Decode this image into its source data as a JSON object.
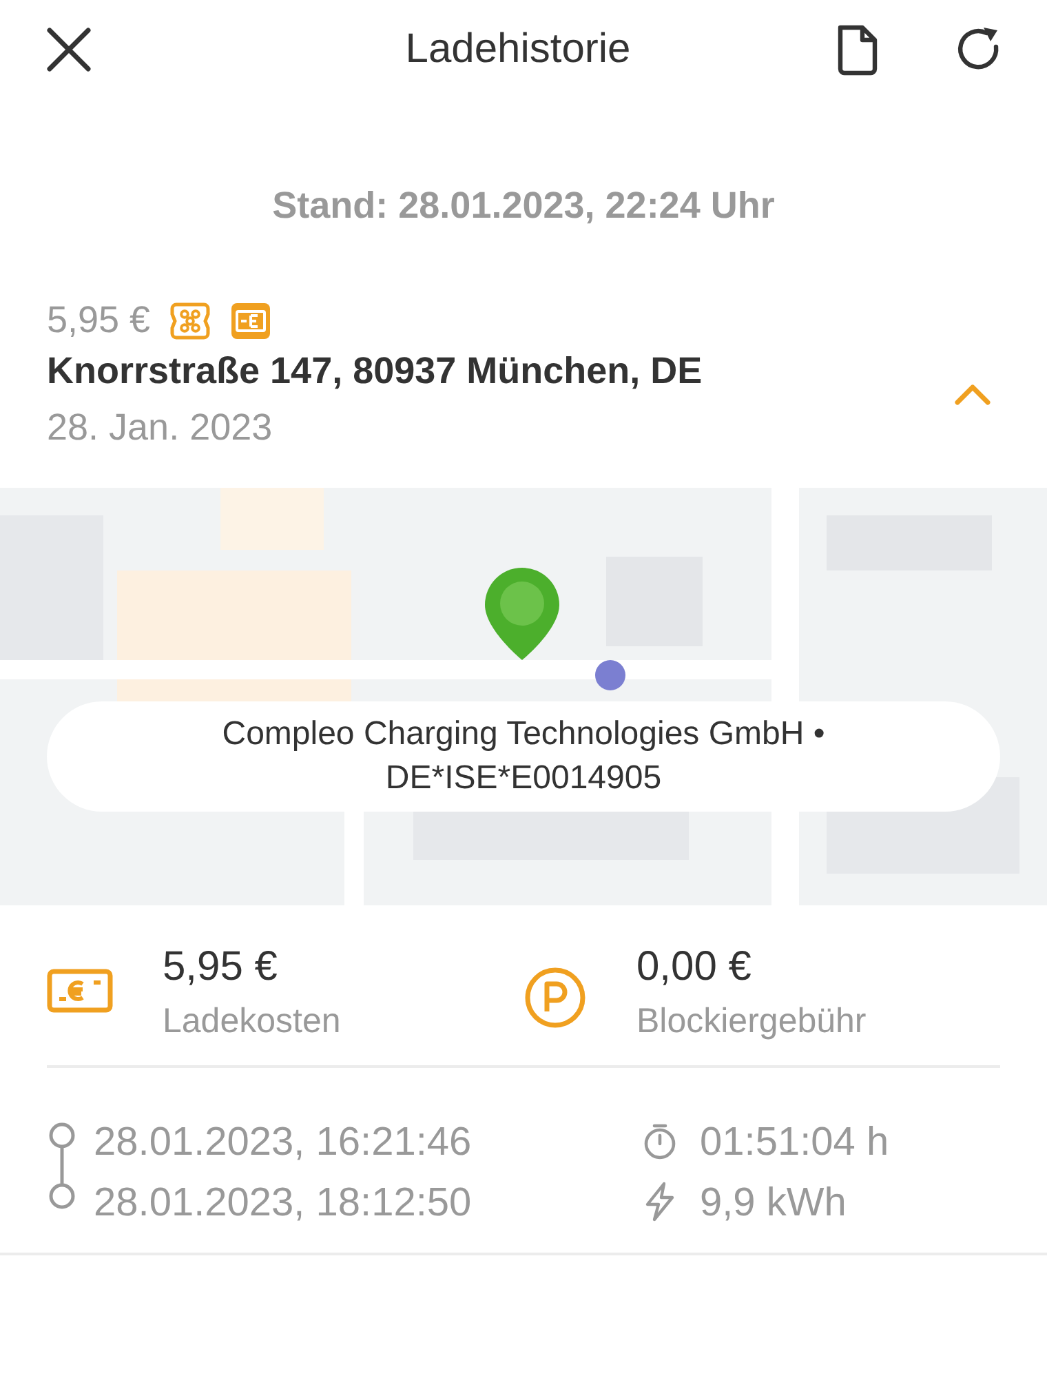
{
  "header": {
    "title": "Ladehistorie"
  },
  "stand": "Stand: 28.01.2023, 22:24 Uhr",
  "session": {
    "price": "5,95 €",
    "address": "Knorrstraße 147, 80937 München, DE",
    "date": "28. Jan. 2023",
    "expanded": true,
    "station": "Compleo Charging Technologies GmbH • DE*ISE*E0014905",
    "costs": [
      {
        "kind": "charging",
        "amount": "5,95 €",
        "label": "Ladekosten"
      },
      {
        "kind": "parking",
        "amount": "0,00 €",
        "label": "Blockiergebühr"
      }
    ],
    "start": "28.01.2023, 16:21:46",
    "end": "28.01.2023, 18:12:50",
    "duration": "01:51:04 h",
    "energy": "9,9 kWh"
  }
}
